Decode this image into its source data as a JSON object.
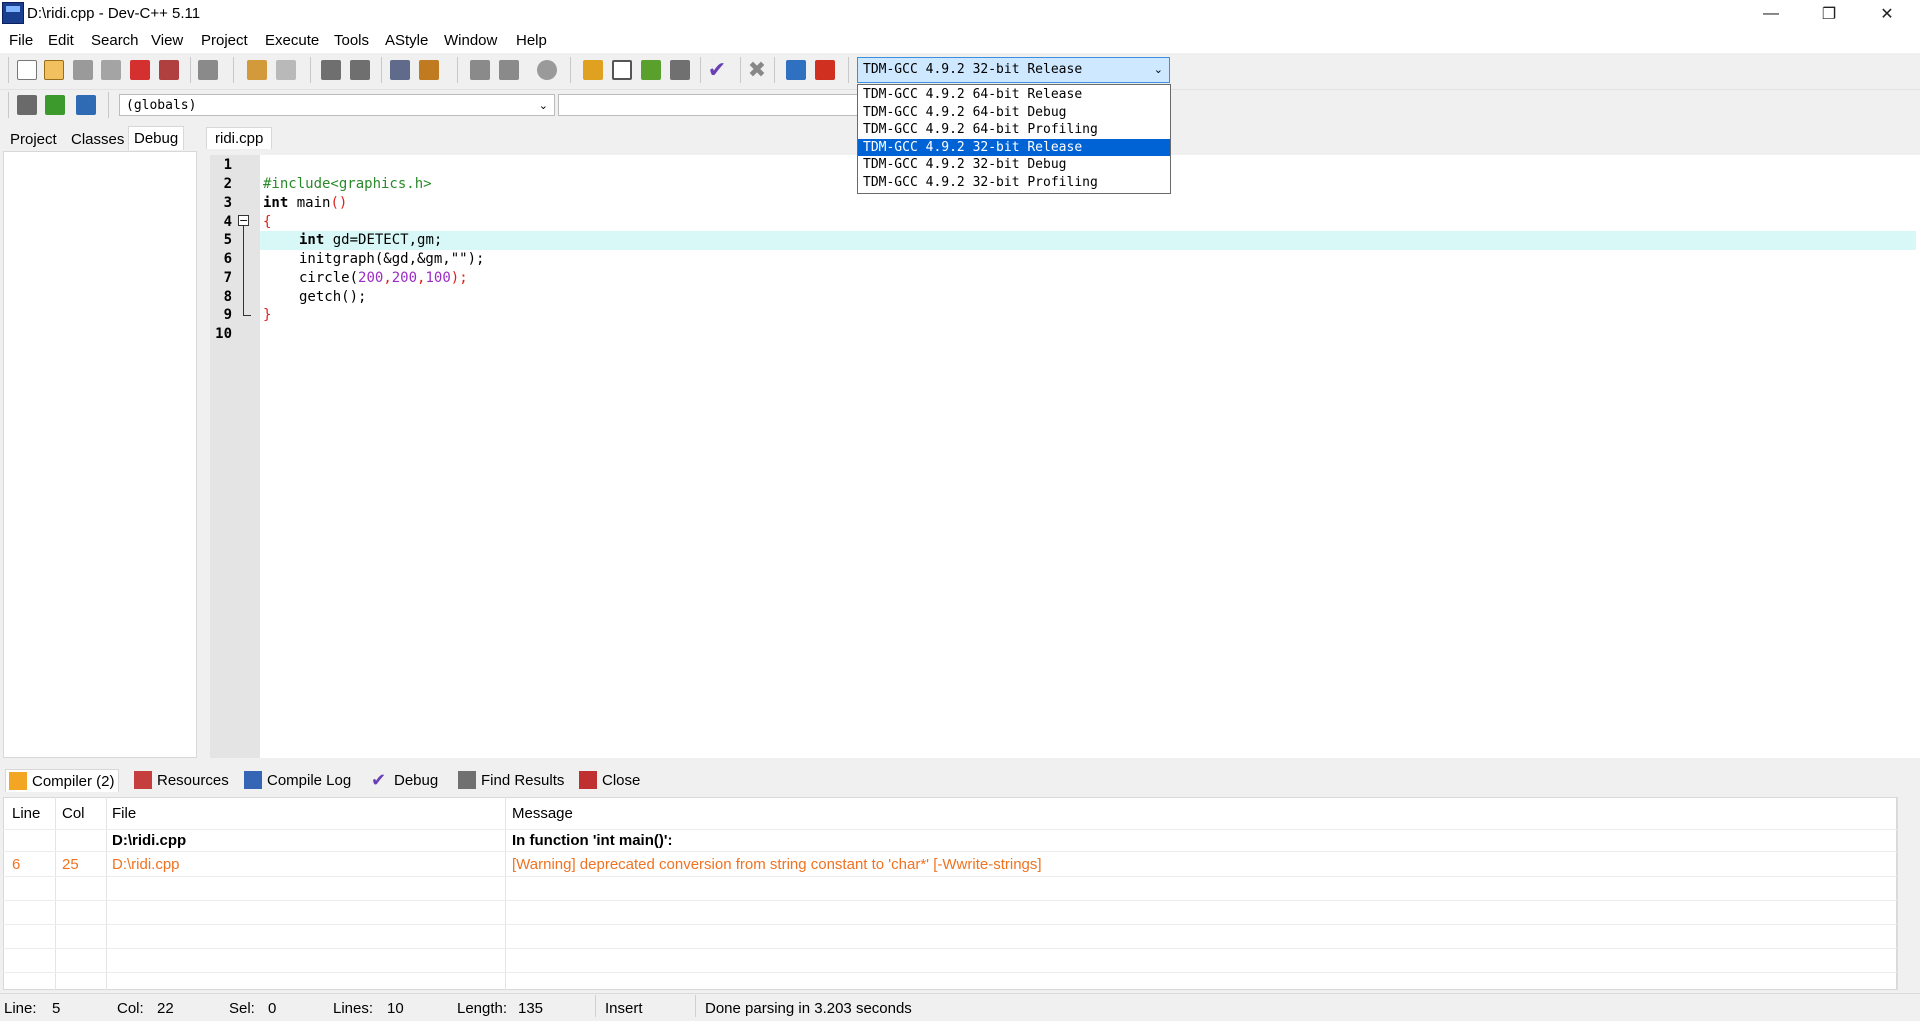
{
  "window": {
    "title": "D:\\ridi.cpp - Dev-C++ 5.11"
  },
  "menu": [
    "File",
    "Edit",
    "Search",
    "View",
    "Project",
    "Execute",
    "Tools",
    "AStyle",
    "Window",
    "Help"
  ],
  "toolbar": {
    "compiler_selected": "TDM-GCC 4.9.2 32-bit Release",
    "compiler_options": [
      "TDM-GCC 4.9.2 64-bit Release",
      "TDM-GCC 4.9.2 64-bit Debug",
      "TDM-GCC 4.9.2 64-bit Profiling",
      "TDM-GCC 4.9.2 32-bit Release",
      "TDM-GCC 4.9.2 32-bit Debug",
      "TDM-GCC 4.9.2 32-bit Profiling"
    ],
    "globals_value": "(globals)"
  },
  "left_tabs": [
    "Project",
    "Classes",
    "Debug"
  ],
  "editor": {
    "tab": "ridi.cpp",
    "line_numbers": [
      "1",
      "2",
      "3",
      "4",
      "5",
      "6",
      "7",
      "8",
      "9",
      "10"
    ],
    "lines": {
      "l2": "#include<graphics.h>",
      "l3_kw": "int",
      "l3_rest": " main",
      "l5_kw": "int",
      "l5_rest": " gd=DETECT,gm;",
      "l6": "initgraph(&gd,&gm,\"\");",
      "l7_a": "circle(",
      "l7_n1": "200",
      "l7_n2": "200",
      "l7_n3": "100",
      "l7_b": ");",
      "l8": "getch();"
    }
  },
  "bottom_tabs": [
    "Compiler (2)",
    "Resources",
    "Compile Log",
    "Debug",
    "Find Results",
    "Close"
  ],
  "messages": {
    "headers": {
      "line": "Line",
      "col": "Col",
      "file": "File",
      "message": "Message"
    },
    "rows": [
      {
        "line": "",
        "col": "",
        "file": "D:\\ridi.cpp",
        "message": "In function 'int main()':"
      },
      {
        "line": "6",
        "col": "25",
        "file": "D:\\ridi.cpp",
        "message": "[Warning] deprecated conversion from string constant to 'char*' [-Wwrite-strings]"
      }
    ]
  },
  "status": {
    "line_label": "Line:",
    "line_val": "5",
    "col_label": "Col:",
    "col_val": "22",
    "sel_label": "Sel:",
    "sel_val": "0",
    "lines_label": "Lines:",
    "lines_val": "10",
    "length_label": "Length:",
    "length_val": "135",
    "mode": "Insert",
    "message": "Done parsing in 3.203 seconds"
  }
}
